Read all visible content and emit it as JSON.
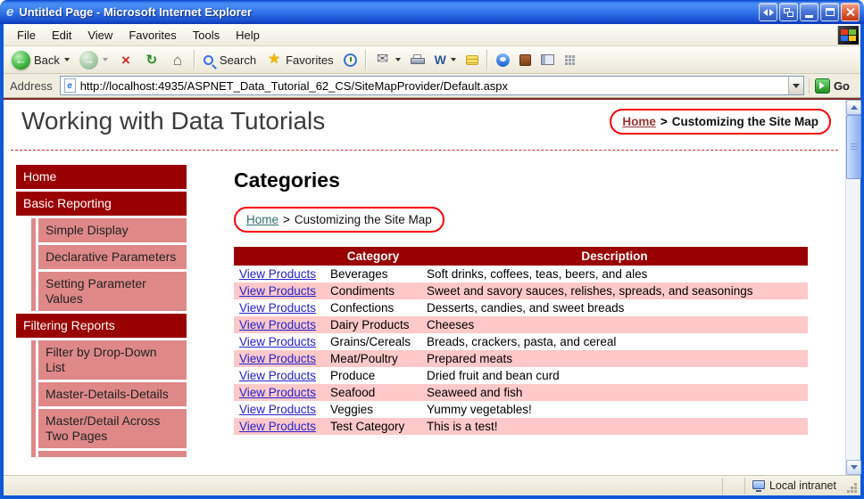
{
  "theme": {
    "titlebar_blue": "#2e6fe8",
    "chrome_tan": "#ece9d8",
    "accent_dark_red": "#990000",
    "sidebar_sub_bg": "#df8888",
    "table_alt_row": "#ffc9c9",
    "annotation_red": "#fb0007",
    "link_blue": "#2222cc",
    "go_green": "#1f8b1f"
  },
  "glyphs": {
    "ie_e": "e",
    "back_arrow": "←",
    "forward_arrow": "→",
    "stop": "×",
    "refresh": "↻",
    "home": "⌂",
    "favorites_star": "★",
    "mail": "✉",
    "edit_w": "W"
  },
  "titlebar": {
    "title": "Untitled Page - Microsoft Internet Explorer"
  },
  "menubar": {
    "items": [
      "File",
      "Edit",
      "View",
      "Favorites",
      "Tools",
      "Help"
    ]
  },
  "toolbar": {
    "back_label": "Back",
    "search_label": "Search",
    "favorites_label": "Favorites"
  },
  "addressbar": {
    "label": "Address",
    "url": "http://localhost:4935/ASPNET_Data_Tutorial_62_CS/SiteMapProvider/Default.aspx",
    "go_label": "Go"
  },
  "page": {
    "header": {
      "title": "Working with Data Tutorials",
      "breadcrumb": {
        "home": "Home",
        "separator": ">",
        "current": "Customizing the Site Map"
      }
    },
    "sidebar": {
      "items": [
        {
          "label": "Home",
          "level": 1
        },
        {
          "label": "Basic Reporting",
          "level": 1
        },
        {
          "label": "Simple Display",
          "level": 2
        },
        {
          "label": "Declarative Parameters",
          "level": 2
        },
        {
          "label": "Setting Parameter Values",
          "level": 2
        },
        {
          "label": "Filtering Reports",
          "level": 1
        },
        {
          "label": "Filter by Drop-Down List",
          "level": 2
        },
        {
          "label": "Master-Details-Details",
          "level": 2
        },
        {
          "label": "Master/Detail Across Two Pages",
          "level": 2
        }
      ]
    },
    "main": {
      "heading": "Categories",
      "breadcrumb": {
        "home": "Home",
        "separator": ">",
        "current": "Customizing the Site Map"
      },
      "table": {
        "headers": {
          "link": "",
          "category": "Category",
          "description": "Description"
        },
        "link_label": "View Products",
        "rows": [
          {
            "category": "Beverages",
            "description": "Soft drinks, coffees, teas, beers, and ales"
          },
          {
            "category": "Condiments",
            "description": "Sweet and savory sauces, relishes, spreads, and seasonings"
          },
          {
            "category": "Confections",
            "description": "Desserts, candies, and sweet breads"
          },
          {
            "category": "Dairy Products",
            "description": "Cheeses"
          },
          {
            "category": "Grains/Cereals",
            "description": "Breads, crackers, pasta, and cereal"
          },
          {
            "category": "Meat/Poultry",
            "description": "Prepared meats"
          },
          {
            "category": "Produce",
            "description": "Dried fruit and bean curd"
          },
          {
            "category": "Seafood",
            "description": "Seaweed and fish"
          },
          {
            "category": "Veggies",
            "description": "Yummy vegetables!"
          },
          {
            "category": "Test Category",
            "description": "This is a test!"
          }
        ]
      }
    }
  },
  "statusbar": {
    "zone": "Local intranet"
  }
}
